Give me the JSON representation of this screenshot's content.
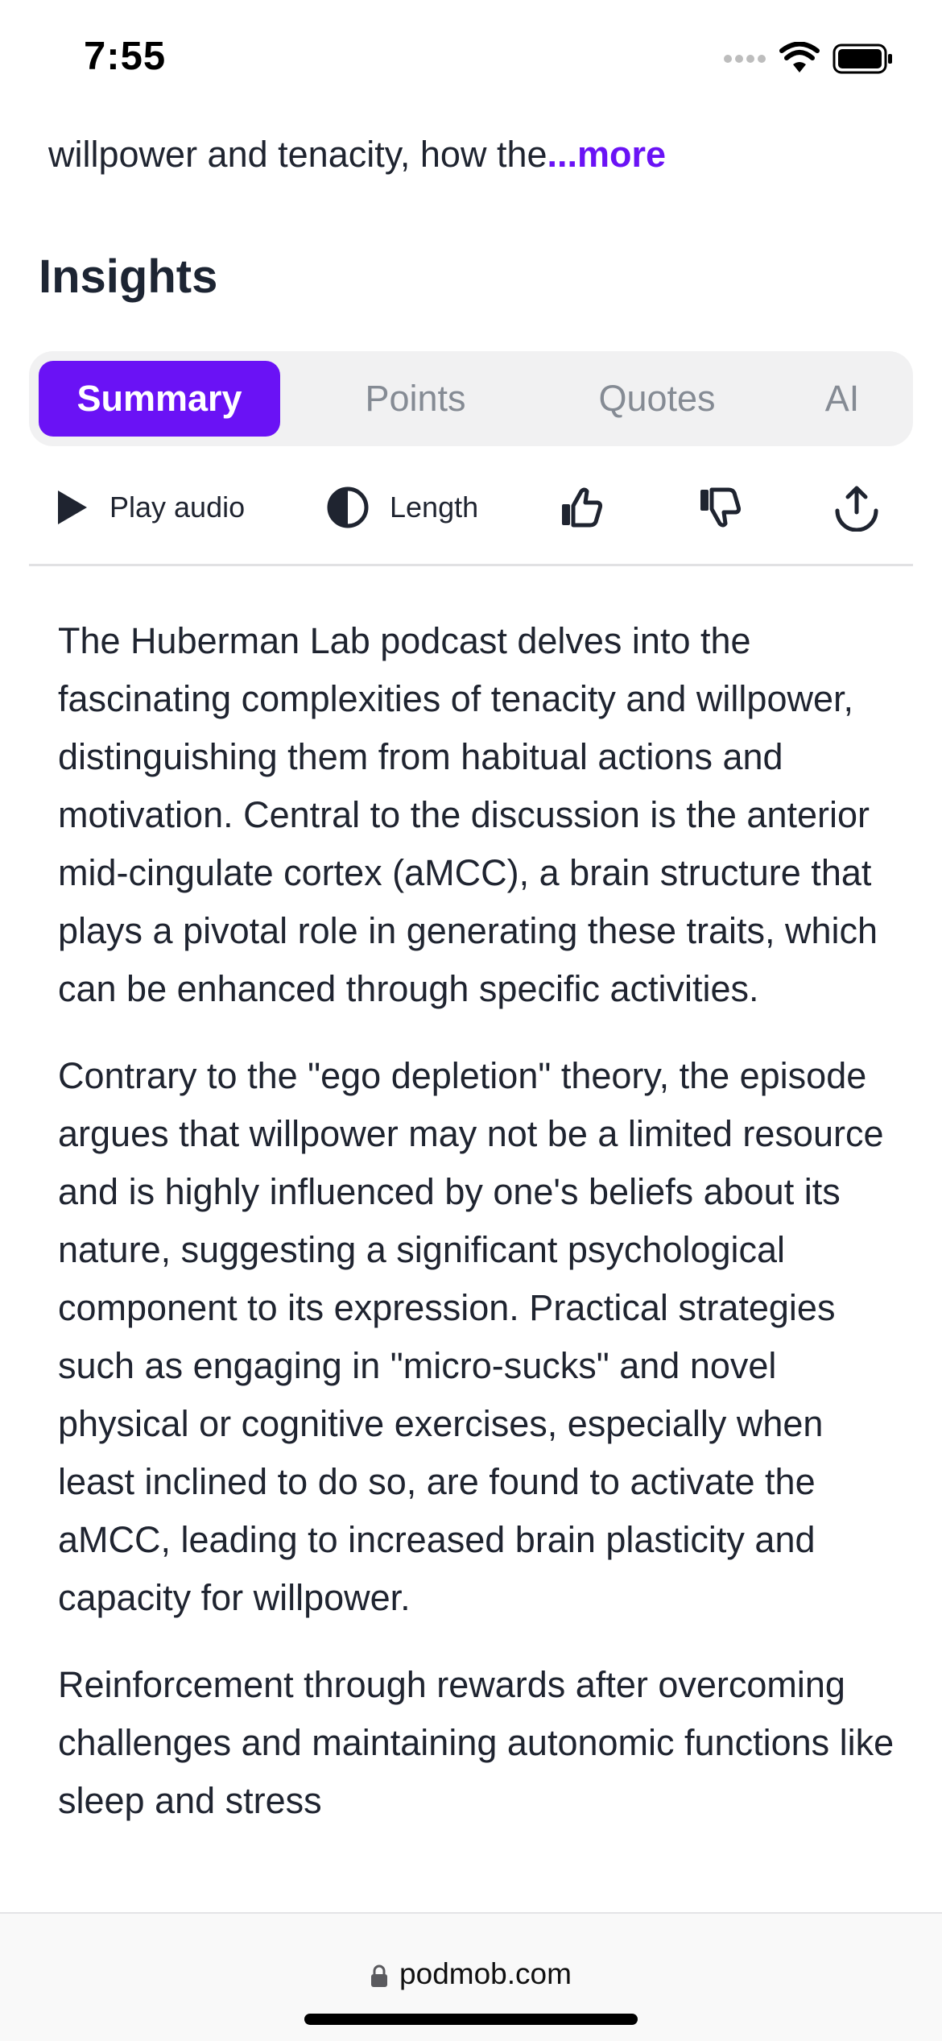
{
  "status_bar": {
    "time": "7:55",
    "icons": [
      "signal-dots-icon",
      "wifi-icon",
      "battery-icon"
    ]
  },
  "description": {
    "visible_line": "willpower and tenacity, how the",
    "more_label": "...more"
  },
  "insights": {
    "title": "Insights",
    "tabs": [
      {
        "label": "Summary",
        "active": true
      },
      {
        "label": "Points",
        "active": false
      },
      {
        "label": "Quotes",
        "active": false
      },
      {
        "label": "AI",
        "active": false
      }
    ],
    "actions": {
      "play_label": "Play audio",
      "length_label": "Length",
      "icons": [
        "play-icon",
        "length-icon",
        "thumbs-up-icon",
        "thumbs-down-icon",
        "share-icon"
      ]
    },
    "summary_paragraphs": [
      "The Huberman Lab podcast delves into the fascinating complexities of tenacity and willpower, distinguishing them from habitual actions and motivation. Central to the discussion is the anterior mid-cingulate cortex (aMCC), a brain structure that plays a pivotal role in generating these traits, which can be enhanced through specific activities.",
      "Contrary to the \"ego depletion\" theory, the episode argues that willpower may not be a limited resource and is highly influenced by one's beliefs about its nature, suggesting a significant psychological component to its expression. Practical strategies such as engaging in \"micro-sucks\" and novel physical or cognitive exercises, especially when least inclined to do so, are found to activate the aMCC, leading to increased brain plasticity and capacity for willpower.",
      "Reinforcement through rewards after overcoming challenges and maintaining autonomic functions like sleep and stress"
    ]
  },
  "browser": {
    "url": "podmob.com"
  },
  "colors": {
    "accent": "#6a12f5",
    "text": "#1f2430",
    "tab_bg": "#f1f1f2",
    "muted": "#858b94"
  }
}
